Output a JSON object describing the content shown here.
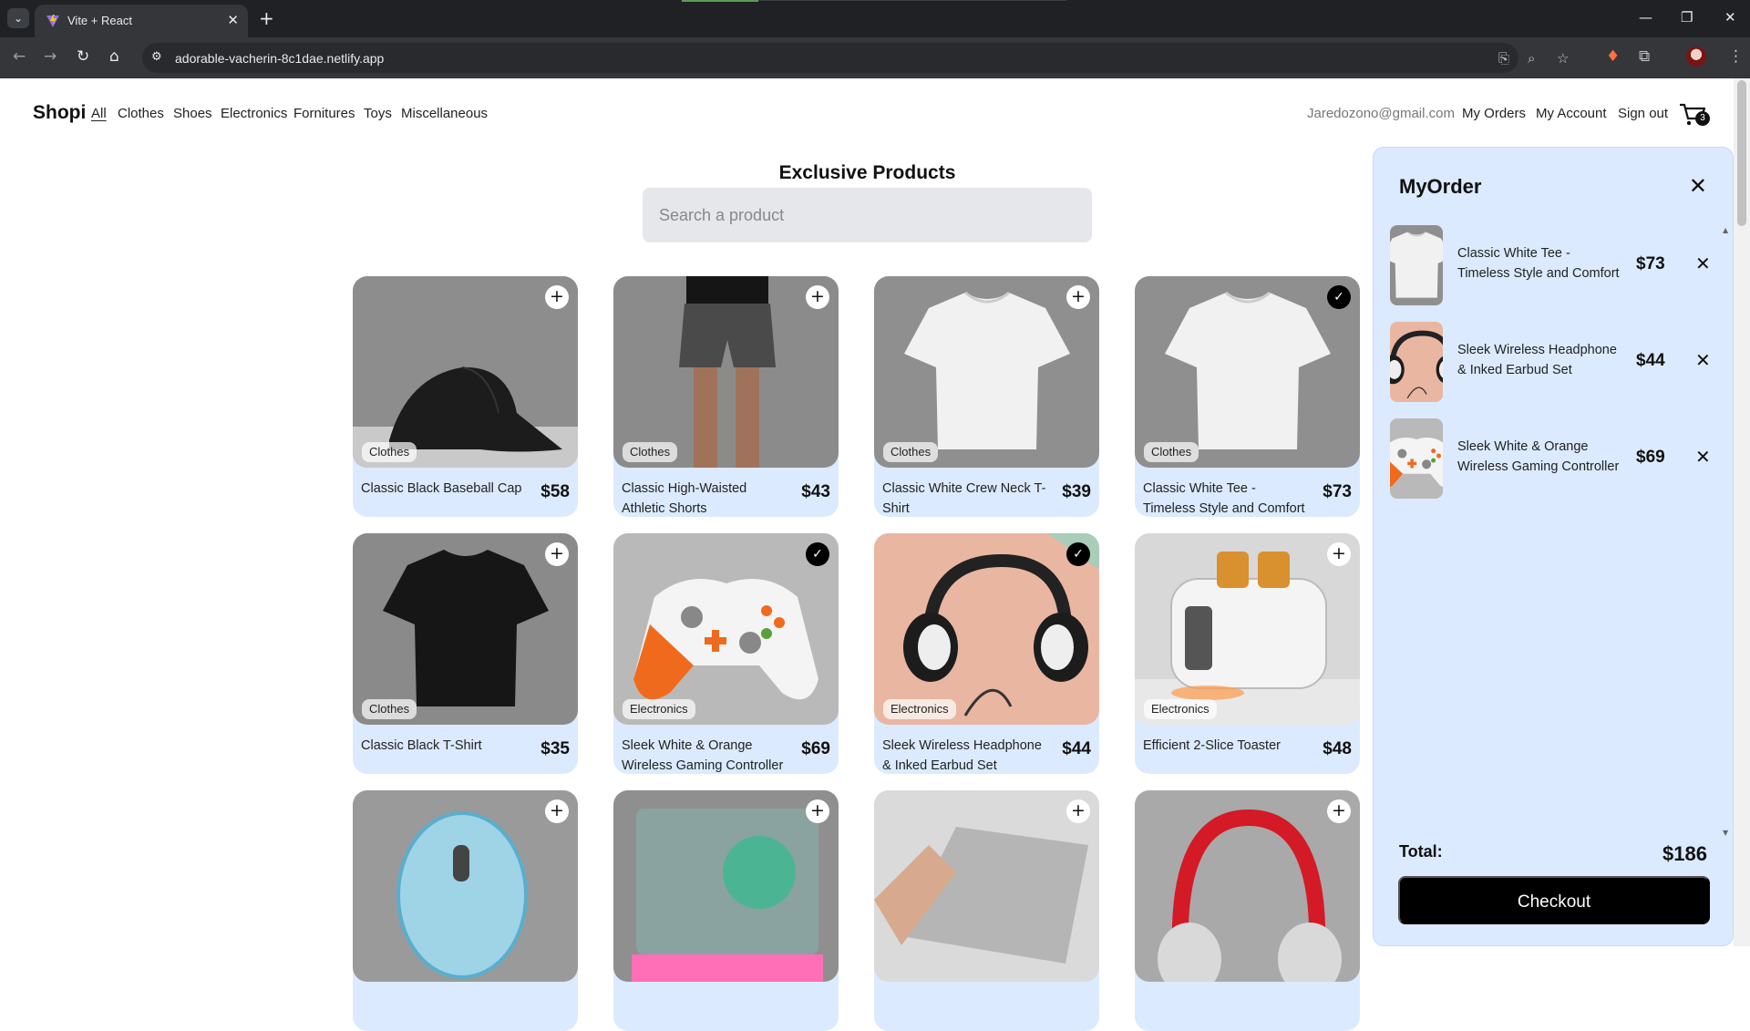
{
  "browser": {
    "tab_title": "Vite + React",
    "url": "adorable-vacherin-8c1dae.netlify.app"
  },
  "navbar": {
    "brand": "Shopi",
    "links": [
      "All",
      "Clothes",
      "Shoes",
      "Electronics",
      "Fornitures",
      "Toys",
      "Miscellaneous"
    ],
    "email": "Jaredozono@gmail.com",
    "my_orders": "My Orders",
    "my_account": "My Account",
    "sign_out": "Sign out",
    "cart_count": "3"
  },
  "main": {
    "heading": "Exclusive Products",
    "search_placeholder": "Search a product"
  },
  "products": [
    {
      "name": "Classic Black Baseball Cap",
      "price": "$58",
      "category": "Clothes",
      "added": false,
      "icon": "cap"
    },
    {
      "name": "Classic High-Waisted Athletic Shorts",
      "price": "$43",
      "category": "Clothes",
      "added": false,
      "icon": "shorts"
    },
    {
      "name": "Classic White Crew Neck T-Shirt",
      "price": "$39",
      "category": "Clothes",
      "added": false,
      "icon": "white-tee"
    },
    {
      "name": "Classic White Tee - Timeless Style and Comfort",
      "price": "$73",
      "category": "Clothes",
      "added": true,
      "icon": "white-tee"
    },
    {
      "name": "Classic Black T-Shirt",
      "price": "$35",
      "category": "Clothes",
      "added": false,
      "icon": "black-tee"
    },
    {
      "name": "Sleek White & Orange Wireless Gaming Controller",
      "price": "$69",
      "category": "Electronics",
      "added": true,
      "icon": "controller"
    },
    {
      "name": "Sleek Wireless Headphone & Inked Earbud Set",
      "price": "$44",
      "category": "Electronics",
      "added": true,
      "icon": "headphones"
    },
    {
      "name": "Efficient 2-Slice Toaster",
      "price": "$48",
      "category": "Electronics",
      "added": false,
      "icon": "toaster"
    },
    {
      "name": "",
      "price": "",
      "category": "",
      "added": false,
      "icon": "mouse"
    },
    {
      "name": "",
      "price": "",
      "category": "",
      "added": false,
      "icon": "laptop-rgb"
    },
    {
      "name": "",
      "price": "",
      "category": "",
      "added": false,
      "icon": "laptop"
    },
    {
      "name": "",
      "price": "",
      "category": "",
      "added": false,
      "icon": "red-headphones"
    }
  ],
  "side_menu": {
    "title": "MyOrder",
    "orders": [
      {
        "name": "Classic White Tee - Timeless Style and Comfort",
        "price": "$73",
        "icon": "white-tee"
      },
      {
        "name": "Sleek Wireless Headphone & Inked Earbud Set",
        "price": "$44",
        "icon": "headphones"
      },
      {
        "name": "Sleek White & Orange Wireless Gaming Controller",
        "price": "$69",
        "icon": "controller"
      }
    ],
    "total_label": "Total:",
    "total_value": "$186",
    "checkout_label": "Checkout"
  }
}
